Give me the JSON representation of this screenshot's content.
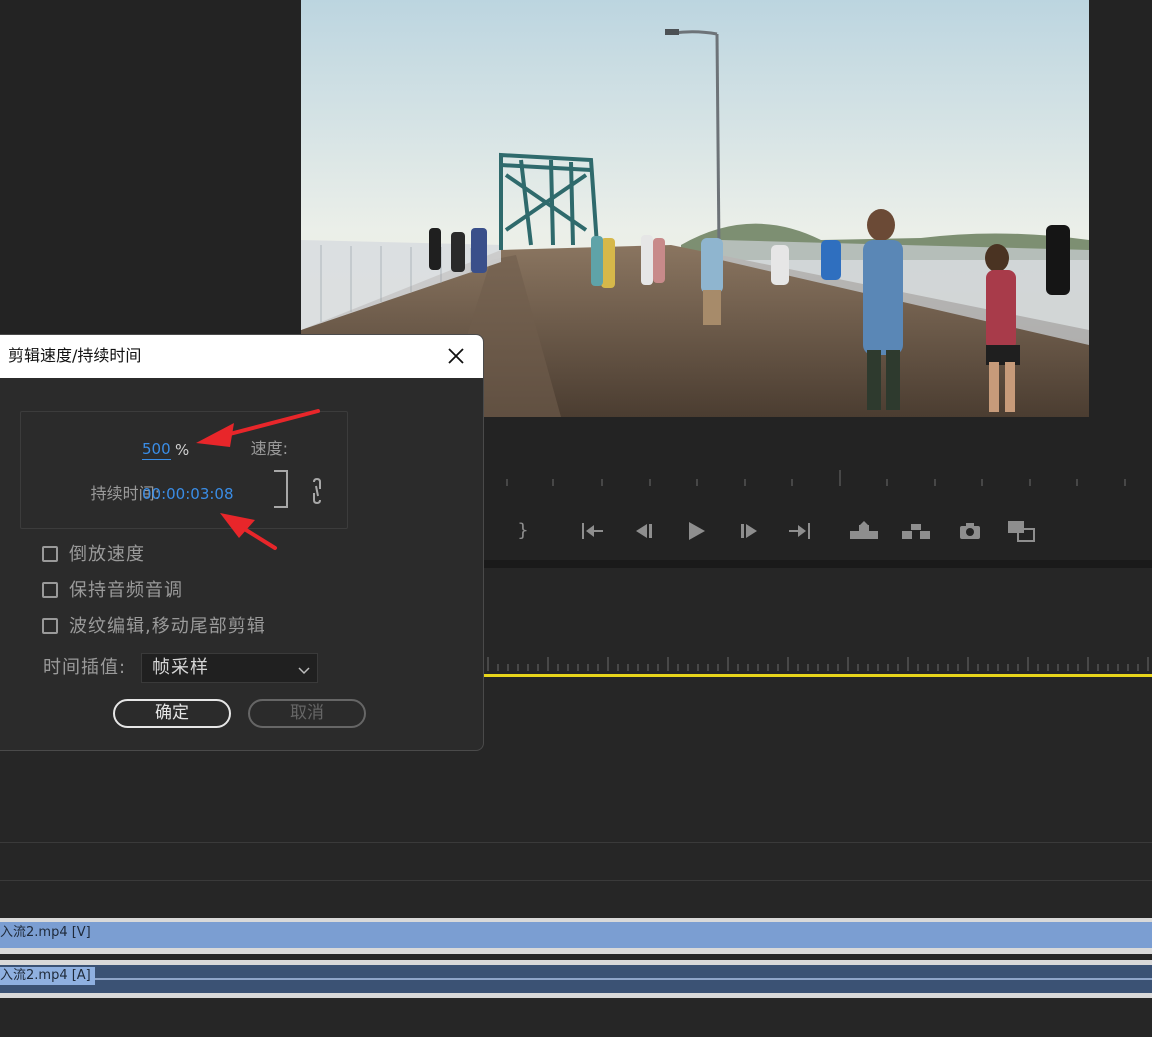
{
  "dialog": {
    "title": "剪辑速度/持续时间",
    "speed_label": "速度:",
    "speed_value": "500",
    "speed_unit": "%",
    "duration_label": "持续时间:",
    "duration_value": "00:00:03:08",
    "reverse_label": "倒放速度",
    "reverse_checked": false,
    "maintain_pitch_label": "保持音频音调",
    "maintain_pitch_checked": false,
    "ripple_label": "波纹编辑,移动尾部剪辑",
    "ripple_checked": false,
    "interp_label": "时间插值:",
    "interp_value": "帧采样",
    "ok_label": "确定",
    "cancel_label": "取消"
  },
  "timeline": {
    "video_clip_label": "入流2.mp4 [V]",
    "audio_clip_label": "入流2.mp4 [A]",
    "playhead_color": "#e8d51b",
    "video_clip_color": "#7b9ed2",
    "audio_clip_color": "#3b5274"
  },
  "transport": {
    "icons": [
      "mark-out-icon",
      "go-to-in-icon",
      "step-back-icon",
      "play-icon",
      "step-forward-icon",
      "go-to-out-icon",
      "lift-icon",
      "extract-icon",
      "export-frame-icon",
      "compare-icon"
    ]
  },
  "annotation": {
    "arrow_color": "#e8262a"
  }
}
